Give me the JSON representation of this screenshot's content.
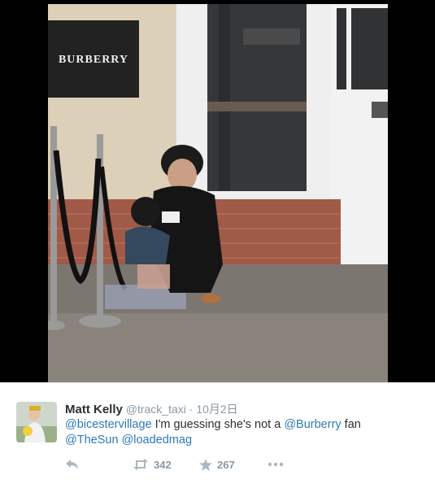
{
  "photo": {
    "store_sign": "BURBERRY"
  },
  "tweet": {
    "author_name": "Matt Kelly",
    "author_handle": "@track_taxi",
    "separator": "·",
    "date": "10月2日",
    "text_parts": {
      "m1": "@bicestervillage",
      "t1": " I'm guessing she's not a ",
      "m2": "@Burberry",
      "t2": " fan",
      "m3": "@TheSun",
      "m4": "@loadedmag"
    },
    "retweet_count": "342",
    "favorite_count": "267"
  },
  "icons": {
    "reply": "reply-icon",
    "retweet": "retweet-icon",
    "favorite": "star-icon",
    "more": "more-icon"
  },
  "colors": {
    "link": "#2b7bb9",
    "meta": "#8899a6",
    "text": "#292f33"
  }
}
